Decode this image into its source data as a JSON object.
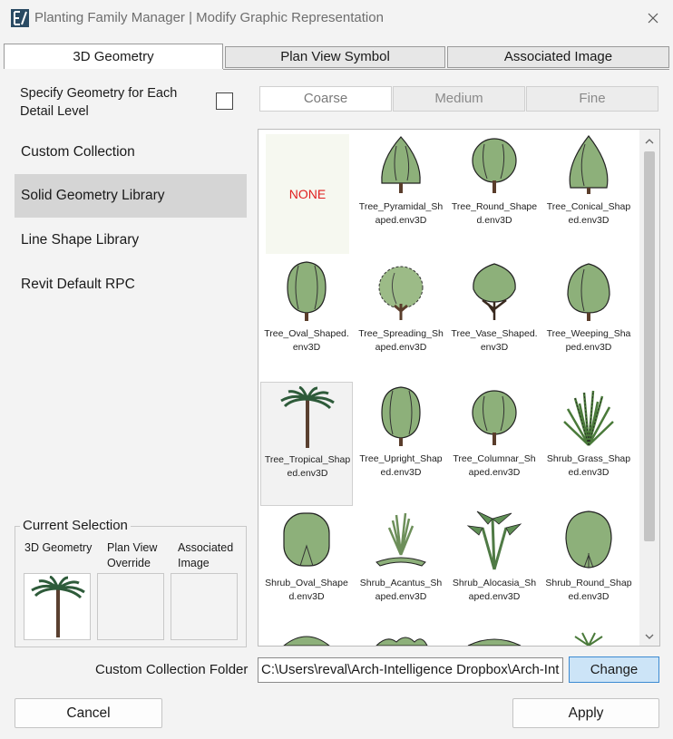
{
  "window": {
    "title": "Planting Family Manager | Modify Graphic Representation",
    "icon": "app-logo-icon",
    "close_icon": "close-icon"
  },
  "main_tabs": [
    {
      "label": "3D Geometry",
      "active": true
    },
    {
      "label": "Plan View Symbol",
      "active": false
    },
    {
      "label": "Associated Image",
      "active": false
    }
  ],
  "specify": {
    "label": "Specify Geometry for Each Detail Level",
    "checked": false
  },
  "sidebar": {
    "items": [
      {
        "label": "Custom Collection",
        "active": false
      },
      {
        "label": "Solid Geometry Library",
        "active": true
      },
      {
        "label": "Line Shape Library",
        "active": false
      },
      {
        "label": "Revit Default RPC",
        "active": false
      }
    ]
  },
  "detail_tabs": [
    {
      "label": "Coarse",
      "active": true
    },
    {
      "label": "Medium",
      "active": false
    },
    {
      "label": "Fine",
      "active": false
    }
  ],
  "gallery": {
    "none_label": "NONE",
    "items": [
      {
        "label": "Tree_Pyramidal_Shaped.env3D",
        "icon": "pyramidal-tree-icon"
      },
      {
        "label": "Tree_Round_Shaped.env3D",
        "icon": "round-tree-icon"
      },
      {
        "label": "Tree_Conical_Shaped.env3D",
        "icon": "conical-tree-icon"
      },
      {
        "label": "Tree_Oval_Shaped.env3D",
        "icon": "oval-tree-icon"
      },
      {
        "label": "Tree_Spreading_Shaped.env3D",
        "icon": "spreading-tree-icon"
      },
      {
        "label": "Tree_Vase_Shaped.env3D",
        "icon": "vase-tree-icon"
      },
      {
        "label": "Tree_Weeping_Shaped.env3D",
        "icon": "weeping-tree-icon"
      },
      {
        "label": "Tree_Tropical_Shaped.env3D",
        "icon": "palm-tree-icon",
        "selected": true
      },
      {
        "label": "Tree_Upright_Shaped.env3D",
        "icon": "upright-tree-icon"
      },
      {
        "label": "Tree_Columnar_Shaped.env3D",
        "icon": "columnar-tree-icon"
      },
      {
        "label": "Shrub_Grass_Shaped.env3D",
        "icon": "grass-shrub-icon"
      },
      {
        "label": "Shrub_Oval_Shaped.env3D",
        "icon": "oval-shrub-icon"
      },
      {
        "label": "Shrub_Acantus_Shaped.env3D",
        "icon": "acantus-shrub-icon"
      },
      {
        "label": "Shrub_Alocasia_Shaped.env3D",
        "icon": "alocasia-shrub-icon"
      },
      {
        "label": "Shrub_Round_Shaped.env3D",
        "icon": "round-shrub-icon"
      }
    ]
  },
  "current_selection": {
    "legend": "Current Selection",
    "col1": "3D Geometry",
    "col2": "Plan View Override",
    "col3": "Associated Image",
    "geometry_icon": "palm-tree-icon"
  },
  "folder": {
    "label": "Custom Collection Folder",
    "value": "C:\\Users\\reval\\Arch-Intelligence Dropbox\\Arch-Int",
    "change_label": "Change"
  },
  "buttons": {
    "cancel": "Cancel",
    "apply": "Apply"
  },
  "colors": {
    "foliage": "#8db07a",
    "foliage_dark": "#2a2a2a",
    "trunk": "#5a3d2b",
    "accent": "#3c8ad2",
    "none_text": "#e02020"
  }
}
